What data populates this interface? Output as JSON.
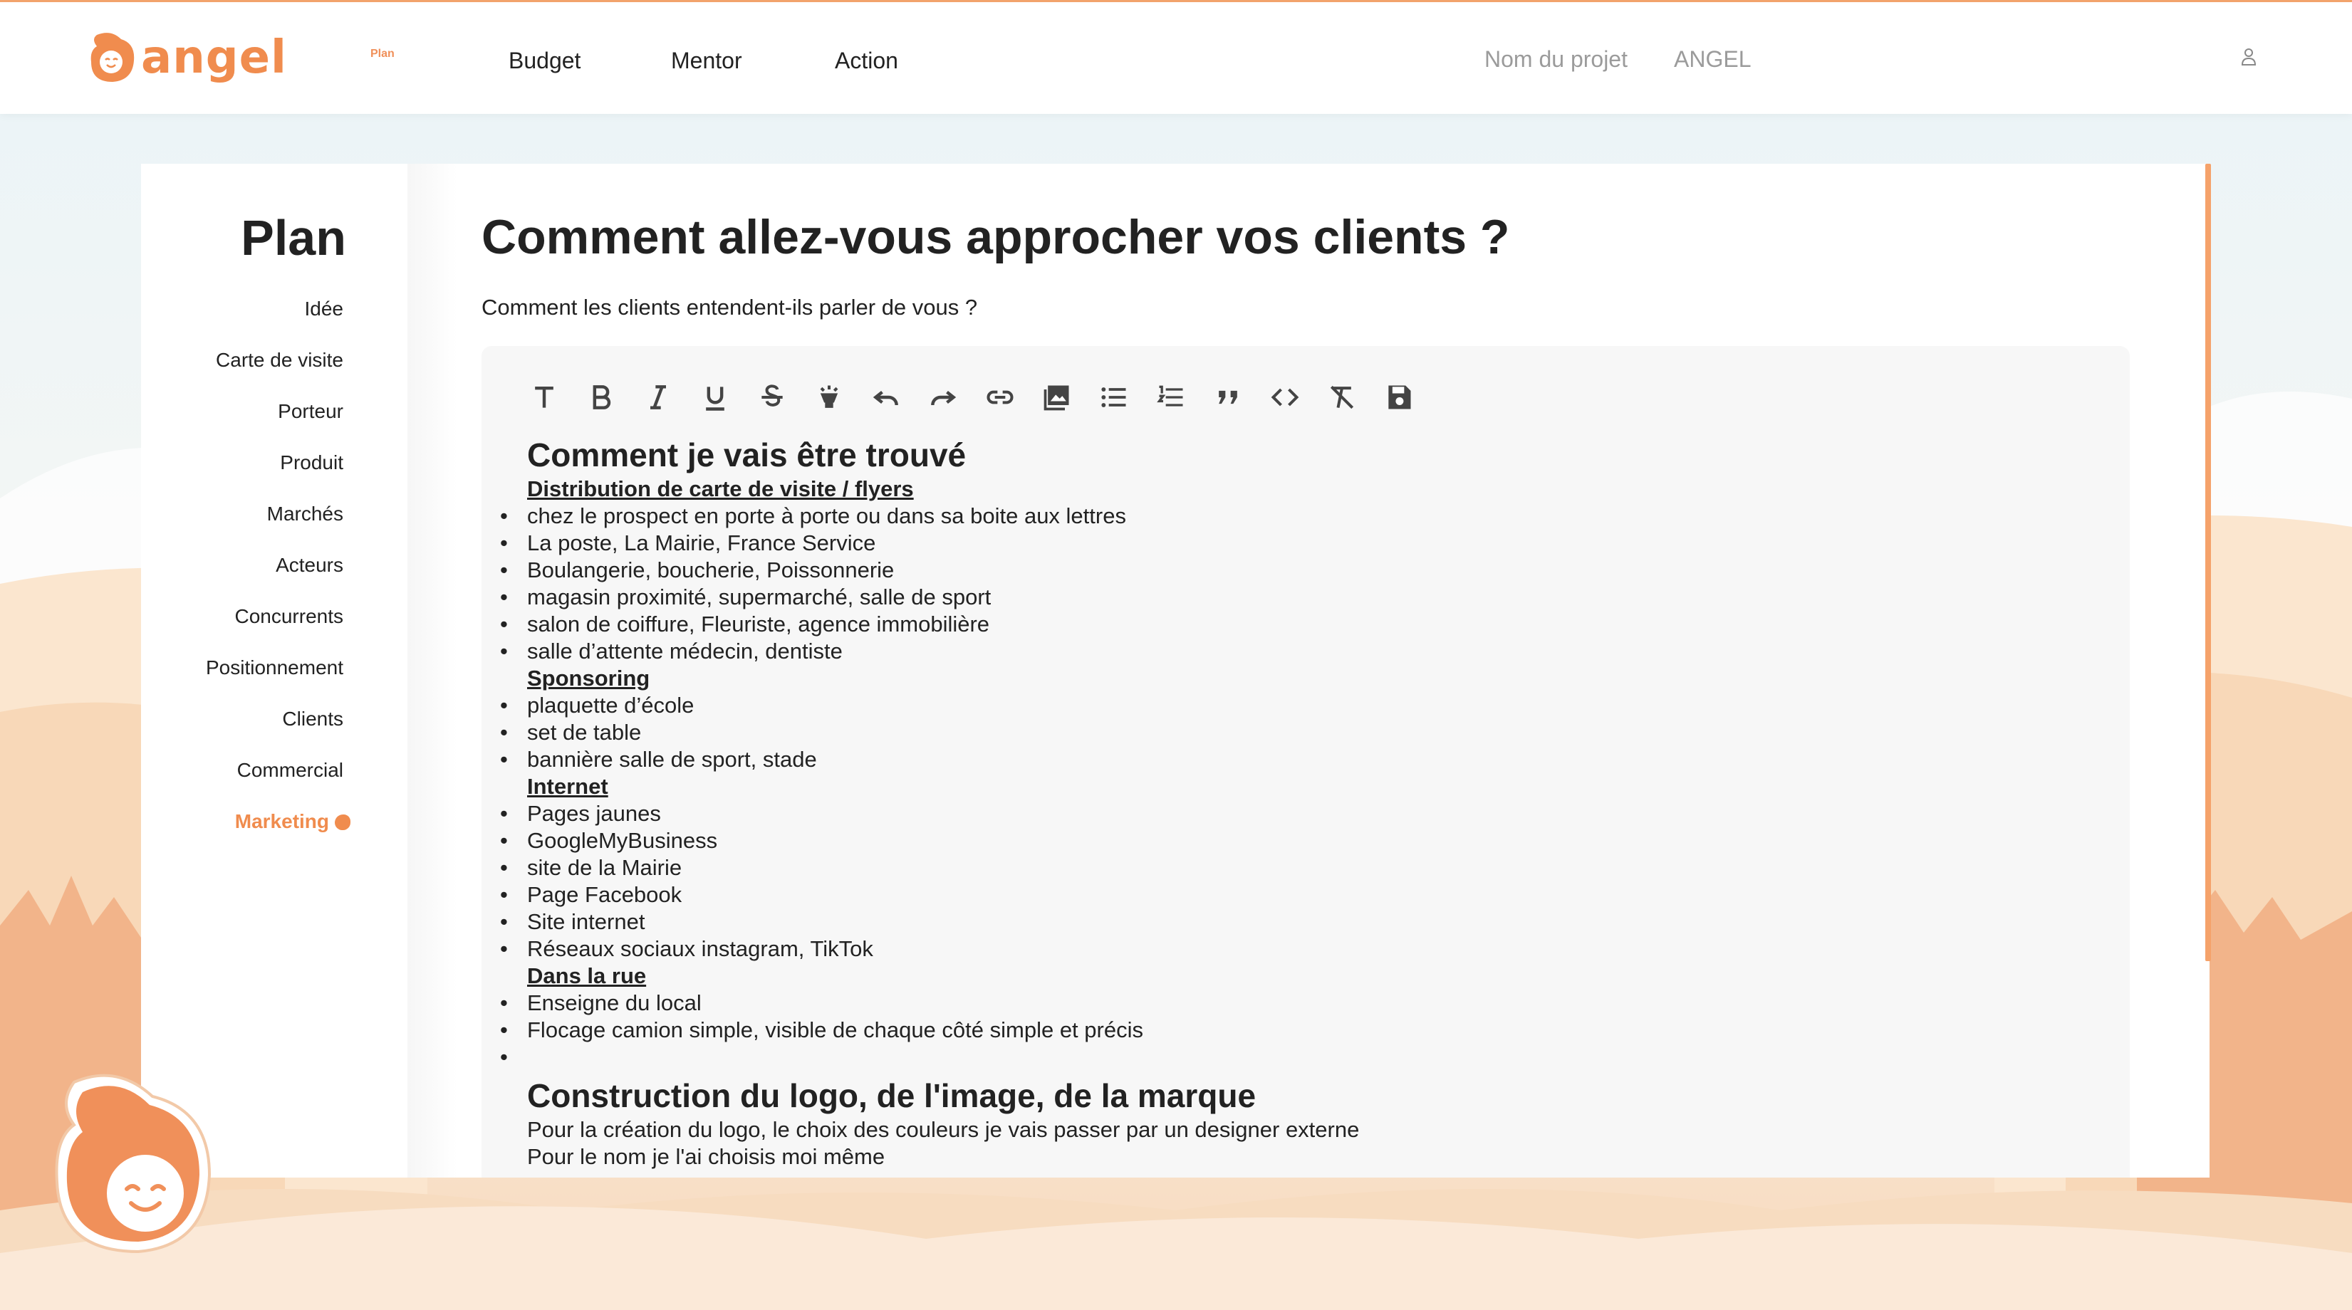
{
  "brand": {
    "name": "angel",
    "accent": "#f08c4e"
  },
  "nav": {
    "items": [
      {
        "label": "Plan",
        "active": true
      },
      {
        "label": "Budget",
        "active": false
      },
      {
        "label": "Mentor",
        "active": false
      },
      {
        "label": "Action",
        "active": false
      }
    ],
    "project_label": "Nom du projet",
    "project_name": "ANGEL",
    "user_icon": "user-icon"
  },
  "sidebar": {
    "title": "Plan",
    "items": [
      {
        "label": "Idée"
      },
      {
        "label": "Carte de visite"
      },
      {
        "label": "Porteur"
      },
      {
        "label": "Produit"
      },
      {
        "label": "Marchés"
      },
      {
        "label": "Acteurs"
      },
      {
        "label": "Concurrents"
      },
      {
        "label": "Positionnement"
      },
      {
        "label": "Clients"
      },
      {
        "label": "Commercial"
      },
      {
        "label": "Marketing",
        "active": true
      }
    ]
  },
  "main": {
    "title": "Comment allez-vous approcher vos clients ?",
    "subtitle": "Comment les clients entendent-ils parler de vous ?"
  },
  "toolbar": {
    "buttons": [
      "heading-icon",
      "bold-icon",
      "italic-icon",
      "underline-icon",
      "strikethrough-icon",
      "highlight-icon",
      "undo-icon",
      "redo-icon",
      "link-icon",
      "image-icon",
      "bullet-list-icon",
      "numbered-list-icon",
      "quote-icon",
      "code-icon",
      "clear-format-icon",
      "save-icon"
    ]
  },
  "editor": {
    "h1": "Comment je vais être trouvé",
    "s1": "Distribution de carte de visite / flyers",
    "l1": [
      "chez le prospect en porte à porte ou dans sa boite aux lettres",
      "La poste, La Mairie, France Service",
      "Boulangerie, boucherie, Poissonnerie",
      "magasin proximité, supermarché, salle de sport",
      "salon de coiffure, Fleuriste, agence immobilière",
      "salle d’attente médecin, dentiste"
    ],
    "s2": "Sponsoring",
    "l2": [
      "plaquette d’école",
      "set de table",
      "bannière salle de sport, stade"
    ],
    "s3": "Internet",
    "l3": [
      "Pages jaunes",
      "GoogleMyBusiness",
      "site de la Mairie",
      "Page Facebook",
      "Site internet",
      "Réseaux sociaux instagram, TikTok"
    ],
    "s4": "Dans la rue",
    "l4": [
      "Enseigne du local",
      "Flocage camion simple, visible de chaque côté simple et précis"
    ],
    "h2": "Construction du logo, de l'image, de la marque",
    "p1": "Pour la création du logo, le choix des couleurs je vais passer par un designer externe",
    "p2": "Pour le nom je l'ai choisis moi même"
  }
}
